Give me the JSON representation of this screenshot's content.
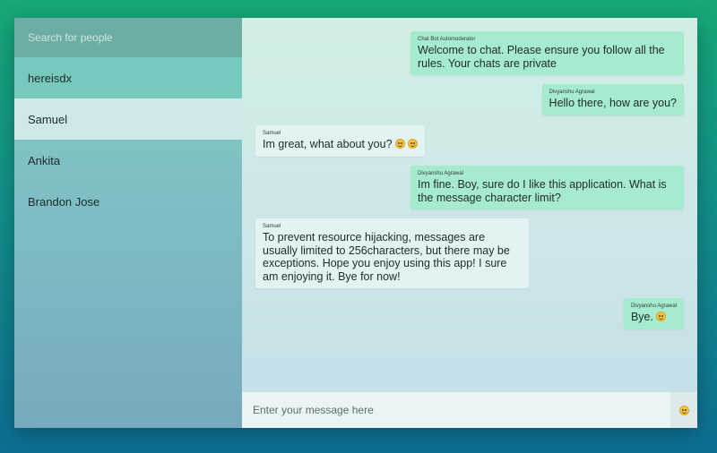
{
  "sidebar": {
    "search_placeholder": "Search for people",
    "contacts": [
      "hereisdx",
      "Samuel",
      "Ankita",
      "Brandon Jose"
    ],
    "active_contact": "Samuel"
  },
  "messages": [
    {
      "sender": "Chat Bot Automoderator",
      "text": "Welcome to chat. Please ensure you follow all the rules. Your chats are private",
      "direction": "outgoing"
    },
    {
      "sender": "Divyanshu Agrawal",
      "text": "Hello there, how are you?",
      "direction": "outgoing"
    },
    {
      "sender": "Samuel",
      "text": "Im great, what about you?",
      "direction": "incoming",
      "emoji": "smiley-emoji x2"
    },
    {
      "sender": "Divyanshu Agrawal",
      "text": "Im fine. Boy, sure do I like this application. What is the message character limit?",
      "direction": "outgoing"
    },
    {
      "sender": "Samuel",
      "text": "To prevent resource hijacking, messages are usually limited to 256characters, but there may be exceptions. Hope you enjoy using this app! I sure am enjoying it. Bye for now!",
      "direction": "incoming"
    },
    {
      "sender": "Divyanshu Agrawal",
      "text": "Bye.",
      "direction": "outgoing",
      "emoji": "smiley-emoji"
    }
  ],
  "composer": {
    "placeholder": "Enter your message here",
    "emoji_icon": "smiley-emoji-icon"
  },
  "colors": {
    "outgoing_bubble": "#a6ebcd",
    "incoming_bubble": "#e3f3f3",
    "active_contact": "#cfe8ea"
  }
}
